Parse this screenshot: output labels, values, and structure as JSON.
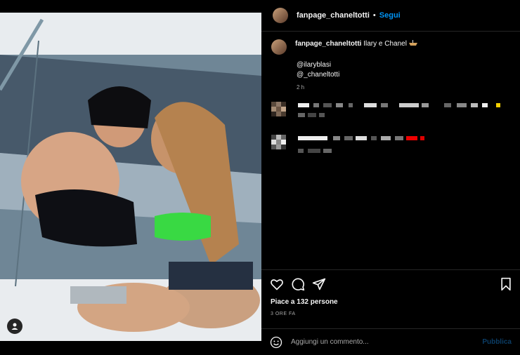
{
  "post": {
    "username": "fanpage_chaneltotti",
    "follow_label": "Segui",
    "separator": "•",
    "caption": "Ilary e Chanel",
    "caption_emoji": "boat-emoji",
    "mentions": [
      "@ilaryblasi",
      "@_chaneltotti"
    ],
    "caption_time": "2 h",
    "likes": "Piace a 132 persone",
    "time_ago": "3 ORE FA"
  },
  "comment_box": {
    "placeholder": "Aggiungi un commento...",
    "post_label": "Pubblica"
  },
  "icons": {
    "like": "heart-icon",
    "comment": "comment-icon",
    "share": "share-icon",
    "save": "bookmark-icon",
    "emoji": "emoji-icon",
    "tagged_user": "user-icon"
  },
  "colors": {
    "accent": "#0095f6",
    "background": "#000000",
    "text": "#f5f5f5",
    "muted": "#a8a8a8"
  }
}
